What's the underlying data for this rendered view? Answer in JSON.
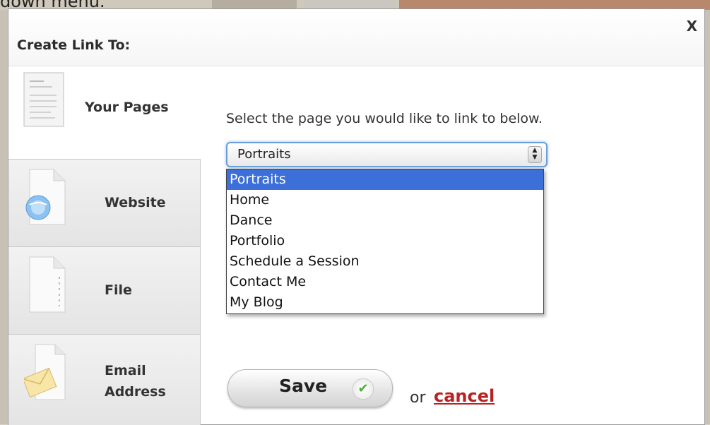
{
  "background": {
    "cropped_text": "down menu."
  },
  "dialog": {
    "title": "Create Link To:",
    "close_label": "X",
    "tabs": [
      {
        "label": "Your Pages",
        "icon": "document-icon",
        "active": true
      },
      {
        "label": "Website",
        "icon": "globe-document-icon"
      },
      {
        "label": "File",
        "icon": "file-document-icon"
      },
      {
        "label_line1": "Email",
        "label_line2": "Address",
        "icon": "envelope-icon"
      }
    ],
    "instruction": "Select the page you would like to link to below.",
    "select": {
      "value": "Portraits",
      "options": [
        "Portraits",
        "Home",
        "Dance",
        "Portfolio",
        "Schedule a Session",
        "Contact Me",
        "My Blog"
      ],
      "highlighted_index": 0
    },
    "save_label": "Save",
    "or_text": "or",
    "cancel_label": "cancel"
  },
  "colors": {
    "highlight": "#3c6fd8",
    "cancel": "#b82222",
    "check": "#4caf2f",
    "focus_ring": "#6aa0d8"
  }
}
